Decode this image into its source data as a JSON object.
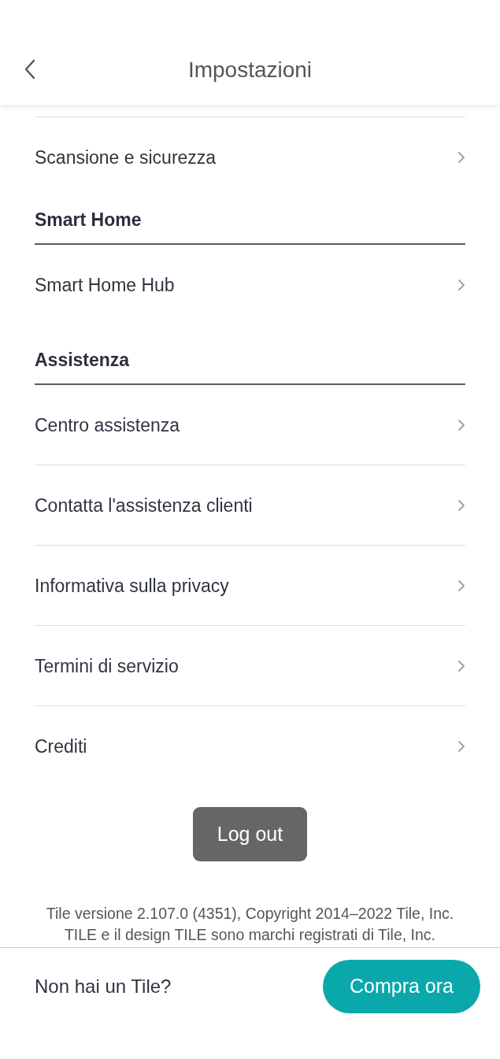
{
  "header": {
    "title": "Impostazioni"
  },
  "sections": [
    {
      "items": [
        {
          "label": "Scansione e sicurezza"
        }
      ]
    },
    {
      "title": "Smart Home",
      "items": [
        {
          "label": "Smart Home Hub"
        }
      ]
    },
    {
      "title": "Assistenza",
      "items": [
        {
          "label": "Centro assistenza"
        },
        {
          "label": "Contatta l'assistenza clienti"
        },
        {
          "label": "Informativa sulla privacy"
        },
        {
          "label": "Termini di servizio"
        },
        {
          "label": "Crediti"
        }
      ]
    }
  ],
  "logout_button": "Log out",
  "footer": {
    "lines": [
      "Tile versione 2.107.0 (4351), Copyright 2014–2022 Tile, Inc.",
      "TILE e il design TILE sono marchi registrati di Tile, Inc."
    ]
  },
  "promo": {
    "text": "Non hai un Tile?",
    "button": "Compra ora"
  }
}
